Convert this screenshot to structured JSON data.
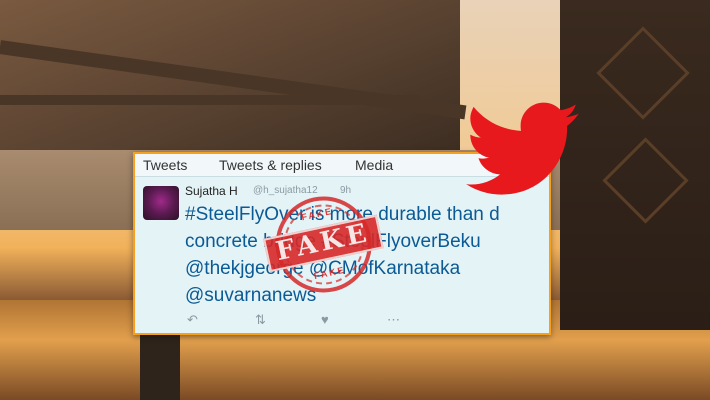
{
  "tweet": {
    "tabs": [
      "Tweets",
      "Tweets & replies",
      "Media"
    ],
    "user_name": "Sujatha H",
    "user_handle": "@h_sujatha12",
    "time": "9h",
    "lines": [
      "#SteelFlyOver is more durable than d",
      "concrete bridge #SteelFlyoverBeku",
      "@thekjgeorge @CMofKarnataka",
      "@suvarnanews"
    ]
  },
  "stamp": {
    "text": "FAKE",
    "small_top": "FAKE",
    "small_bottom": "FAKE"
  },
  "colors": {
    "link": "#0b5a95",
    "stamp": "#d62828",
    "twitter": "#e8191d",
    "card_border": "#f5a020"
  },
  "icons": [
    "reply-icon",
    "retweet-icon",
    "like-icon",
    "more-icon",
    "twitter-bird-icon"
  ]
}
